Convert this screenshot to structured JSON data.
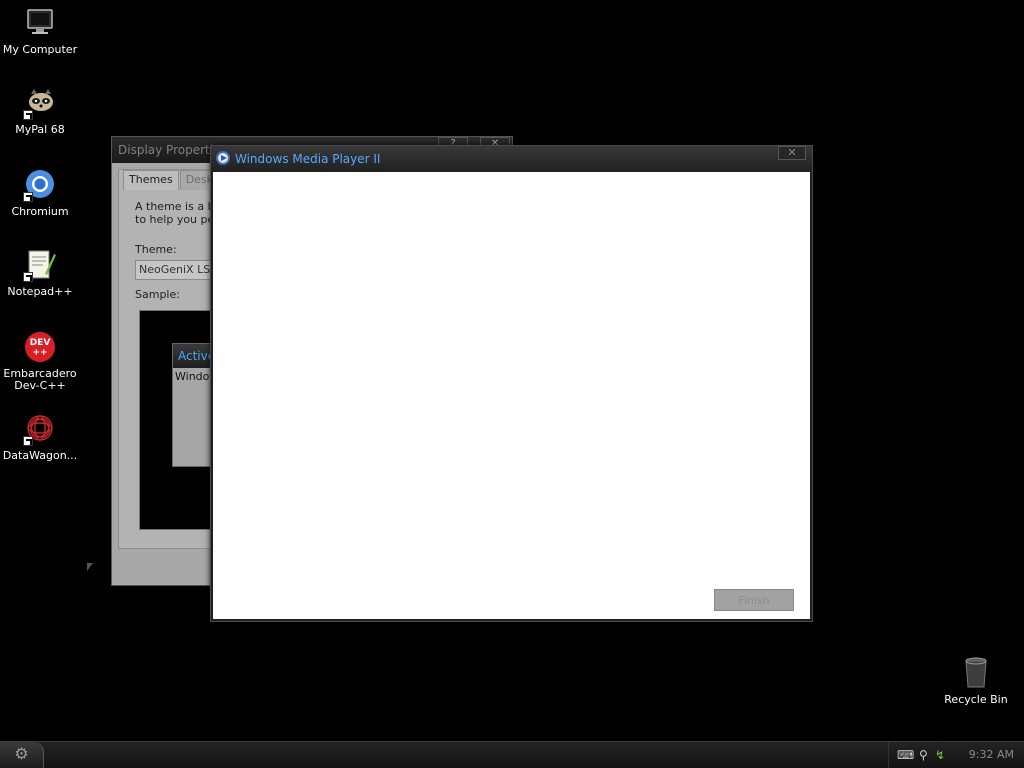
{
  "desktop": {
    "icons": [
      {
        "label": "My Computer"
      },
      {
        "label": "MyPal 68"
      },
      {
        "label": "Chromium"
      },
      {
        "label": "Notepad++"
      },
      {
        "label": "Embarcadero Dev-C++"
      },
      {
        "label": "DataWagon..."
      },
      {
        "label": "Recycle Bin"
      }
    ]
  },
  "display_properties": {
    "title": "Display Properti",
    "help_glyph": "?",
    "close_glyph": "✕",
    "tabs": [
      {
        "label": "Themes"
      },
      {
        "label": "Deskt"
      }
    ],
    "description_line1": "A theme is a bac",
    "description_line2": "to help you pers",
    "theme_label": "Theme:",
    "theme_value": "NeoGeniX LS",
    "sample_label": "Sample:",
    "sample_window_title": "Active",
    "sample_window_text": "Windo"
  },
  "media_player": {
    "title": "Windows Media Player II",
    "close_glyph": "✕",
    "finish_label": "Finish"
  },
  "taskbar": {
    "start_glyph": "⚙",
    "tray_keyboard_glyph": "⌨",
    "tray_antenna_glyph": "⚲",
    "tray_network_glyph": "↯",
    "clock": "9:32 AM"
  },
  "colors": {
    "desktop_bg": "#000000",
    "title_accent": "#5aa8ff",
    "window_body": "#a8a8a8"
  }
}
